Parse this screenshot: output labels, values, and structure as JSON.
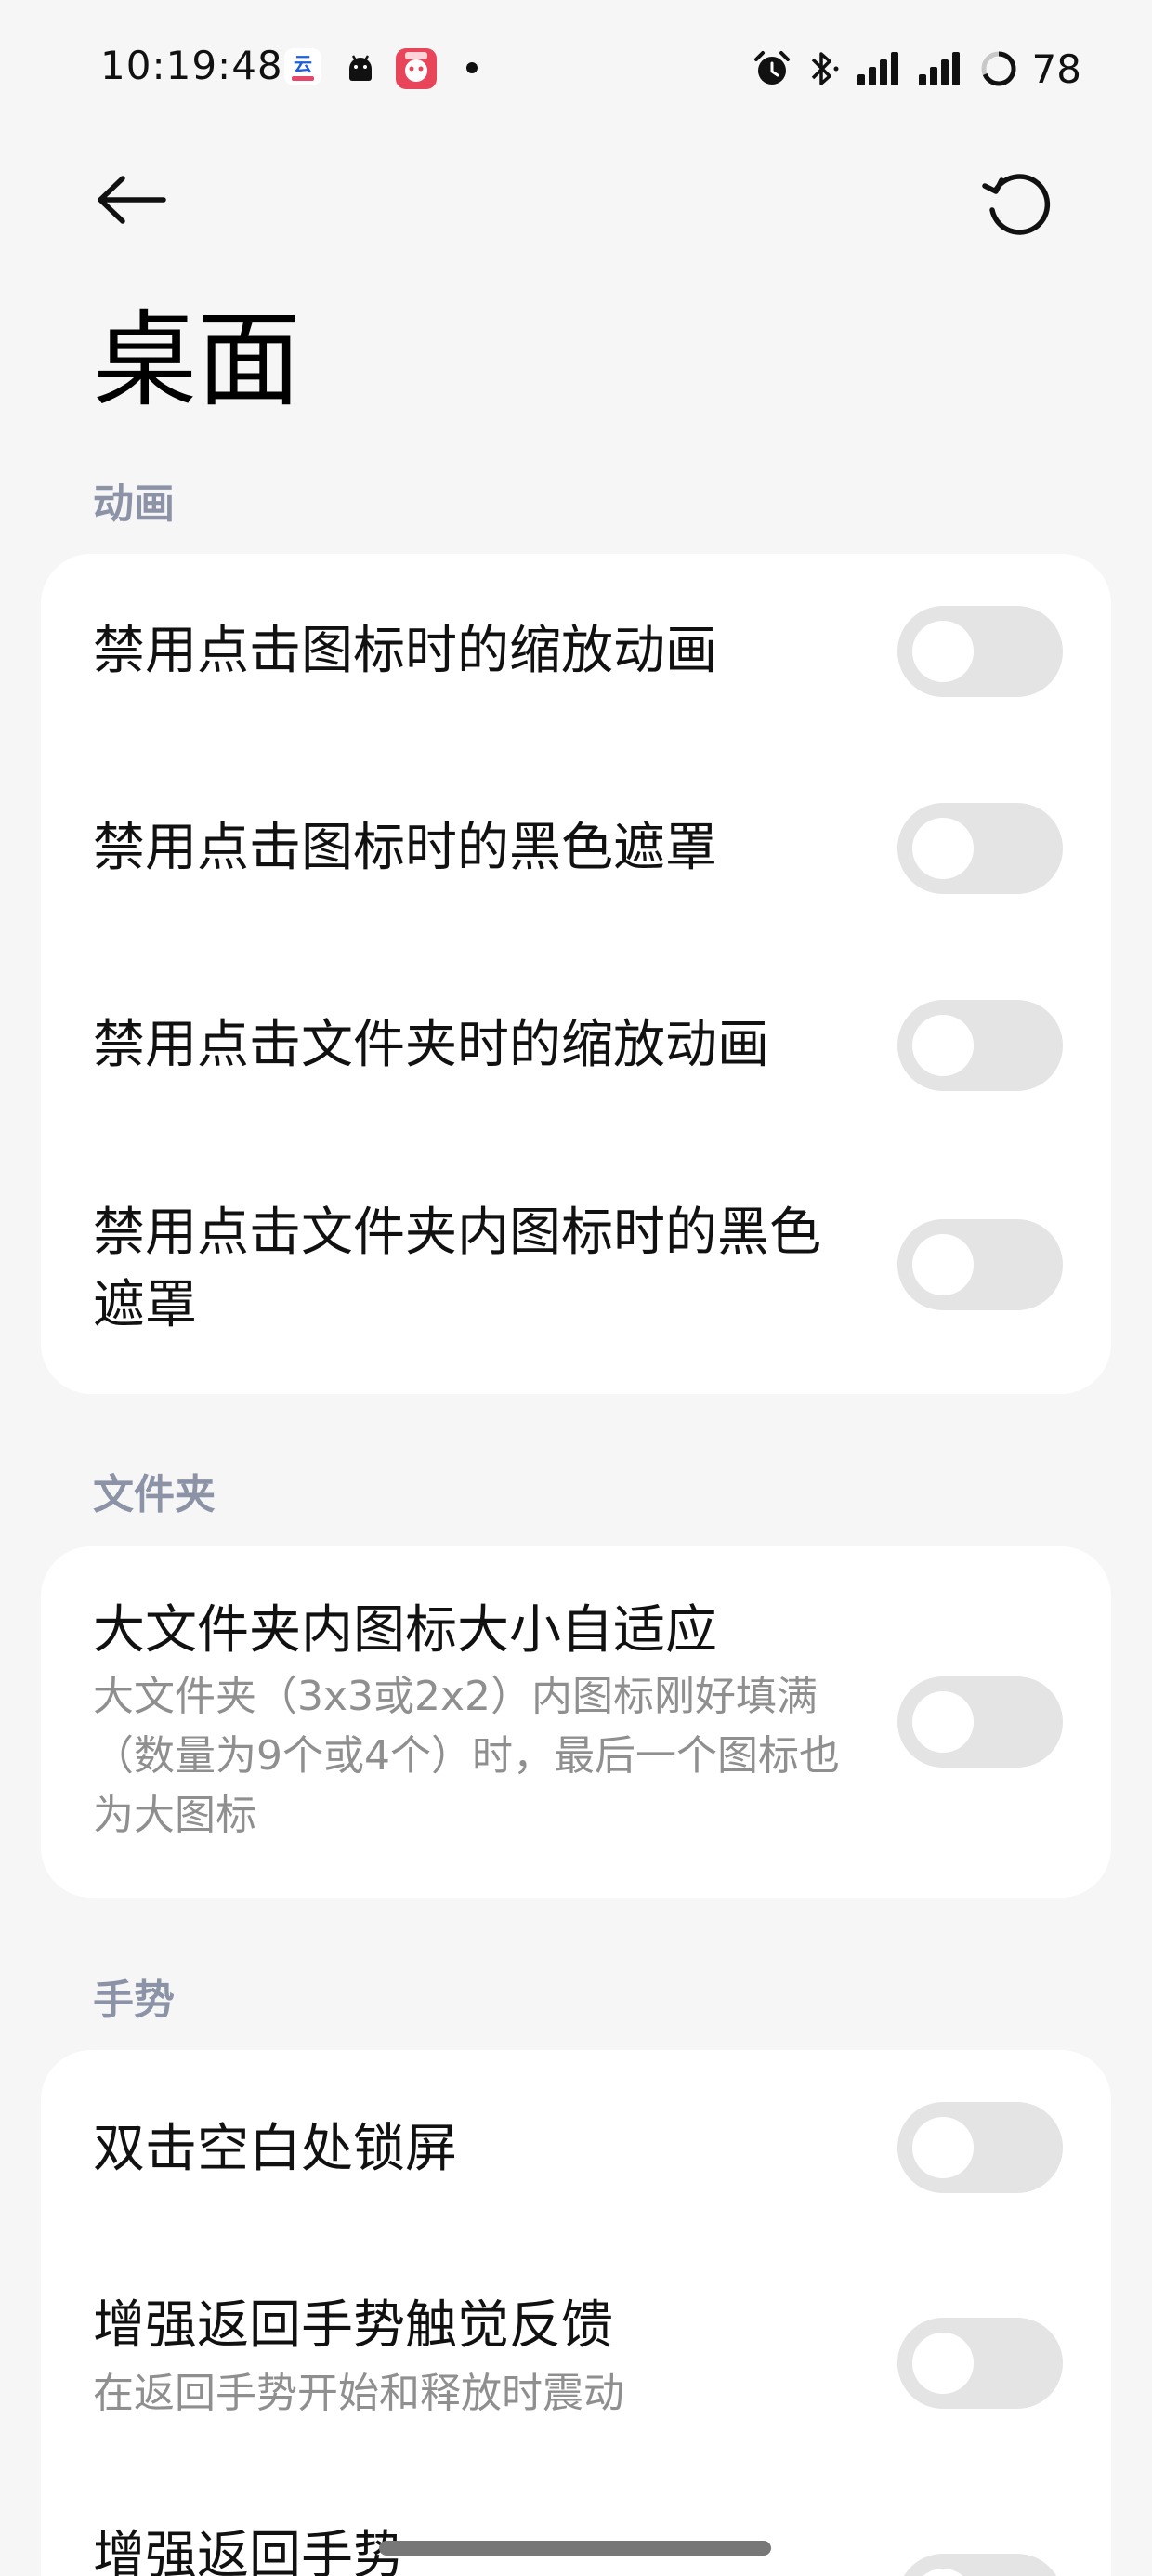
{
  "status_bar": {
    "time": "10:19:48",
    "battery": "78",
    "icons": [
      "alarm-icon",
      "bluetooth-icon",
      "signal-1-icon",
      "signal-2-icon",
      "battery-ring-icon"
    ]
  },
  "header": {
    "back_icon": "back-arrow-icon",
    "refresh_icon": "refresh-icon",
    "title": "桌面"
  },
  "sections": [
    {
      "label": "动画",
      "items": [
        {
          "title": "禁用点击图标时的缩放动画",
          "enabled": false
        },
        {
          "title": "禁用点击图标时的黑色遮罩",
          "enabled": false
        },
        {
          "title": "禁用点击文件夹时的缩放动画",
          "enabled": false
        },
        {
          "title": "禁用点击文件夹内图标时的黑色遮罩",
          "enabled": false
        }
      ]
    },
    {
      "label": "文件夹",
      "items": [
        {
          "title": "大文件夹内图标大小自适应",
          "subtitle": "大文件夹（3x3或2x2）内图标刚好填满（数量为9个或4个）时，最后一个图标也为大图标",
          "enabled": false
        }
      ]
    },
    {
      "label": "手势",
      "items": [
        {
          "title": "双击空白处锁屏",
          "enabled": false
        },
        {
          "title": "增强返回手势触觉反馈",
          "subtitle": "在返回手势开始和释放时震动",
          "enabled": false
        },
        {
          "title": "增强返回手势",
          "enabled": false
        }
      ]
    }
  ],
  "colors": {
    "background": "#f6f6f6",
    "card": "#ffffff",
    "section_label": "#8c93a7",
    "toggle_off": "#e4e4e4",
    "subtitle": "#8f8f8f"
  }
}
